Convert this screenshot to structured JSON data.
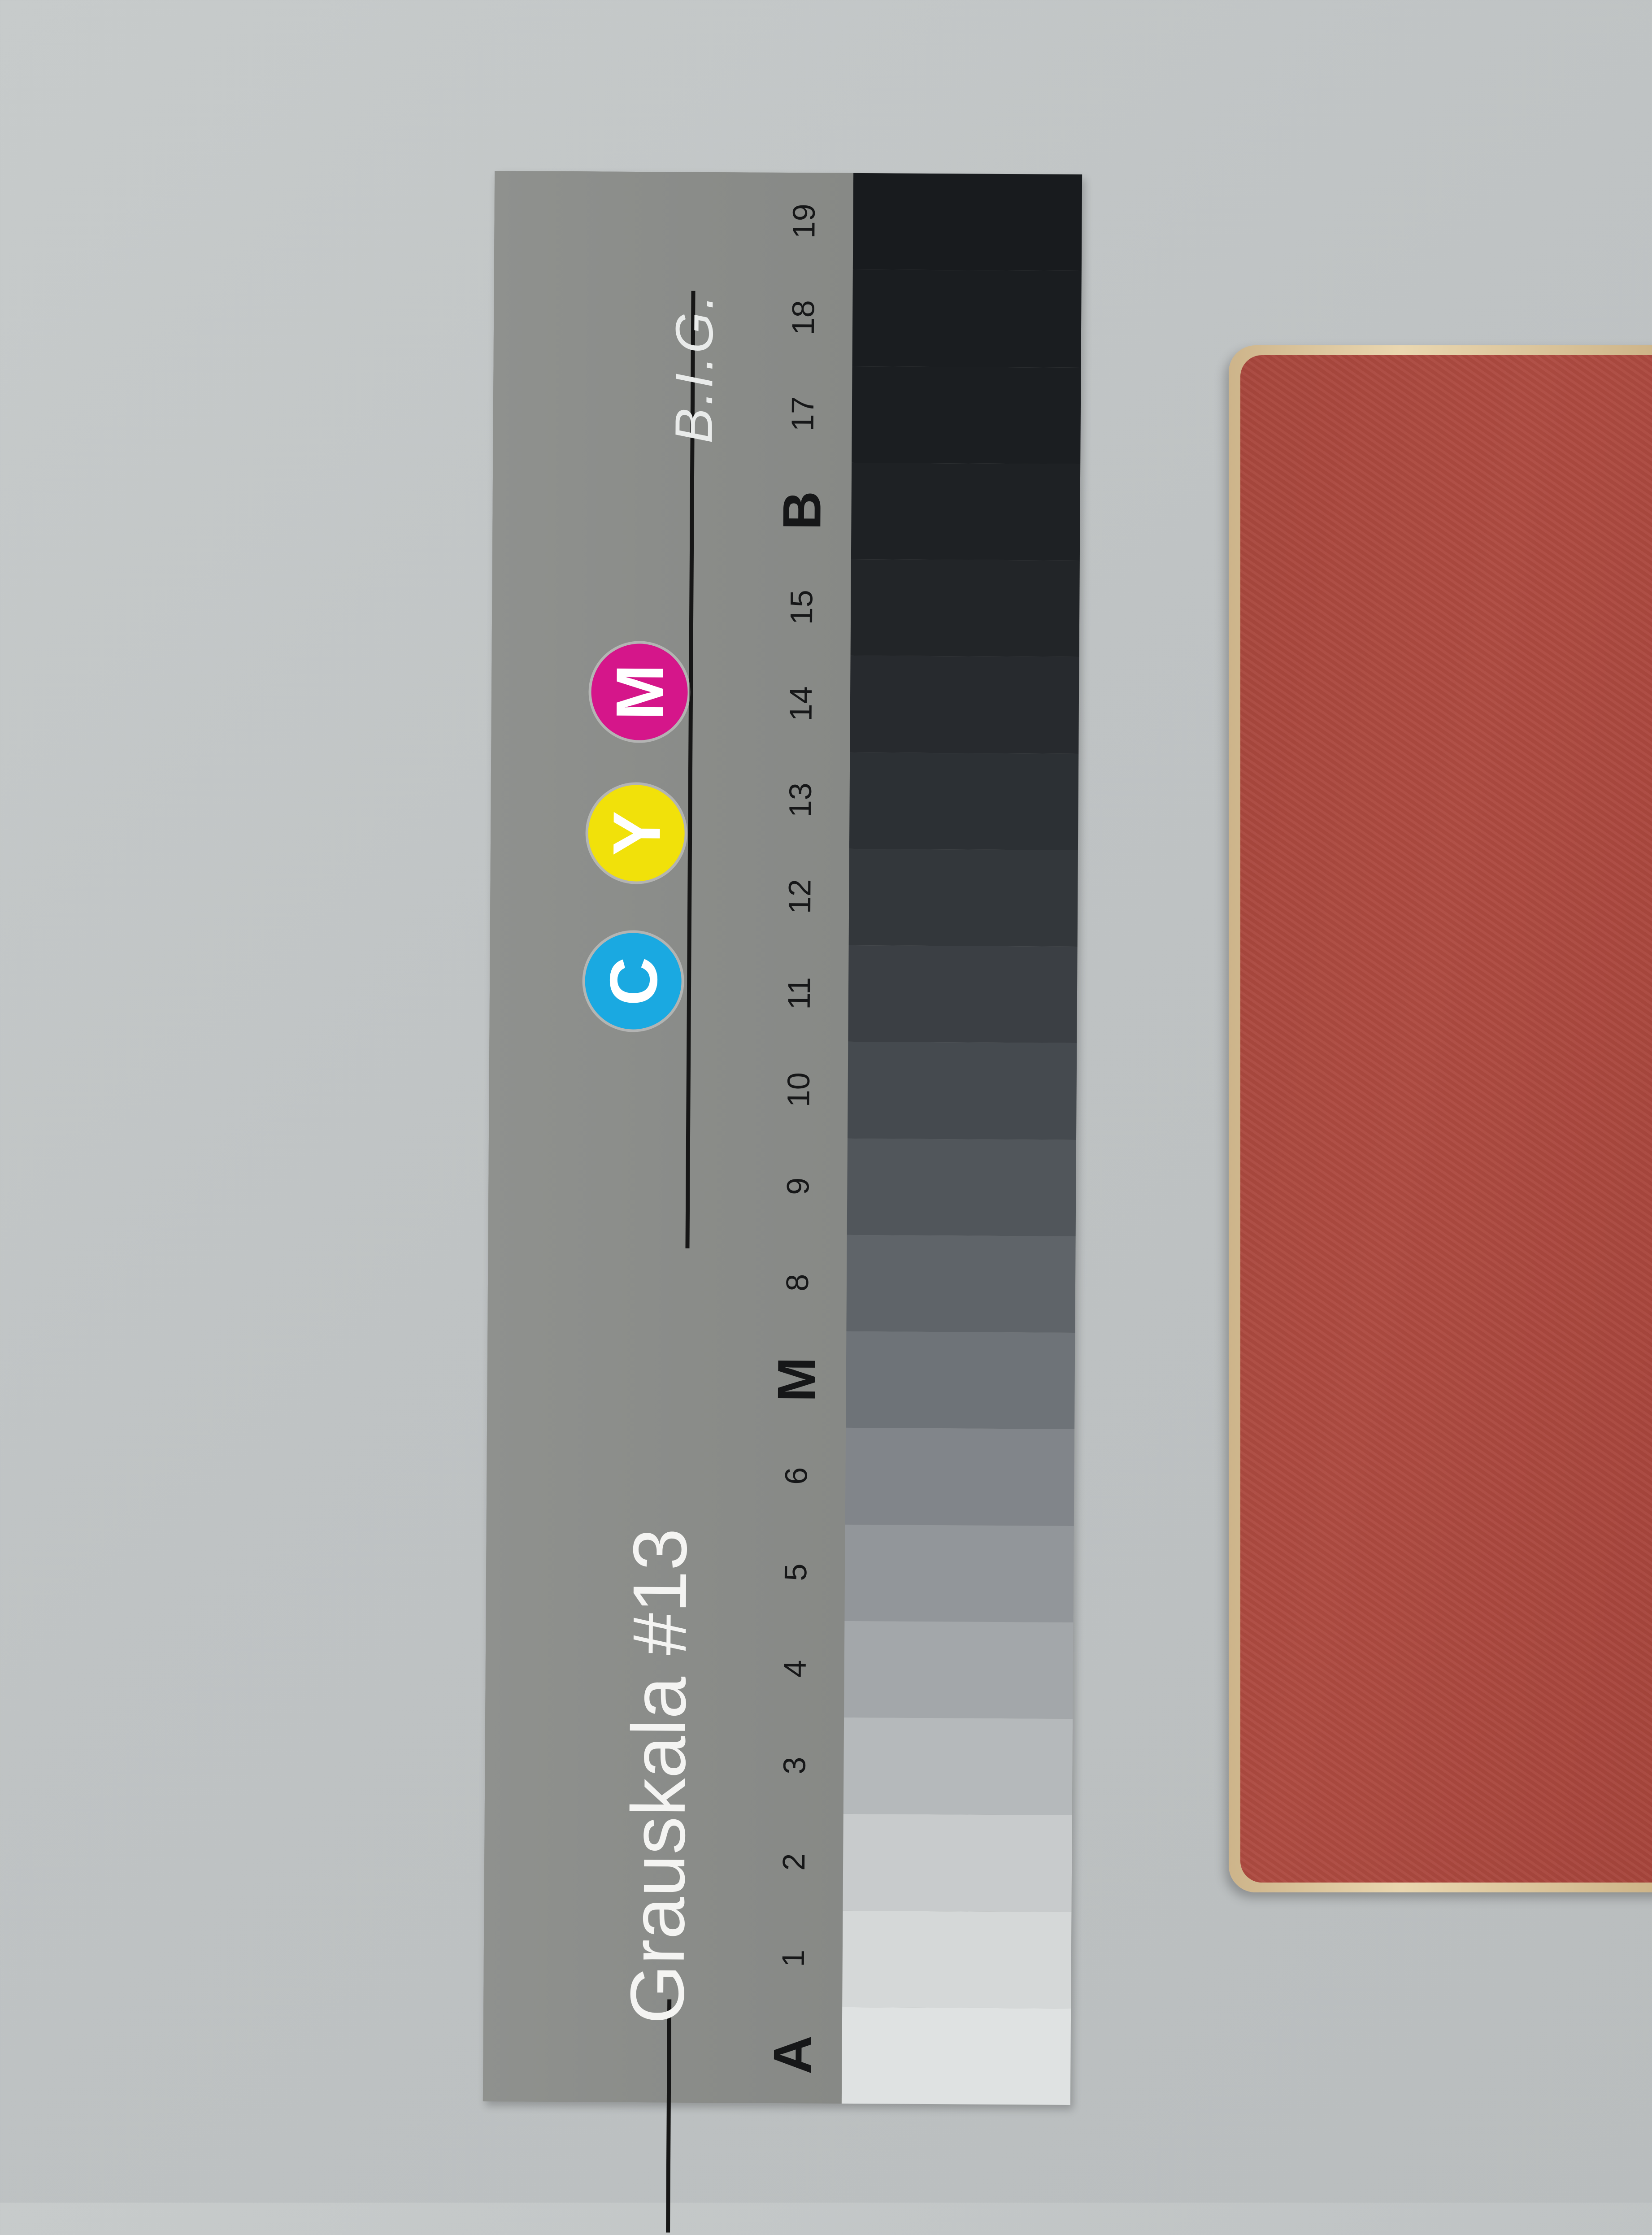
{
  "card": {
    "title": "Grauskala #13",
    "brand": "B.I.G.",
    "badges": [
      {
        "letter": "C",
        "color": "#1aa9e1"
      },
      {
        "letter": "Y",
        "color": "#f1e10a"
      },
      {
        "letter": "M",
        "color": "#d5168a"
      }
    ],
    "scale_labels": [
      "A",
      "1",
      "2",
      "3",
      "4",
      "5",
      "6",
      "M",
      "8",
      "9",
      "10",
      "11",
      "12",
      "13",
      "14",
      "15",
      "B",
      "17",
      "18",
      "19"
    ],
    "patch_colors": [
      "#dfe2e2",
      "#d5d8d8",
      "#c8cbcc",
      "#b5b9bb",
      "#a3a7aa",
      "#92969a",
      "#81858a",
      "#6e7378",
      "#5f6469",
      "#51565b",
      "#454a4f",
      "#3b3f44",
      "#33373b",
      "#2c3034",
      "#272a2e",
      "#222528",
      "#1e2124",
      "#1b1e21",
      "#1a1d20",
      "#181b1e"
    ]
  },
  "book": {
    "cover_color": "#a9473d",
    "edge_color": "#dfc9a0"
  }
}
